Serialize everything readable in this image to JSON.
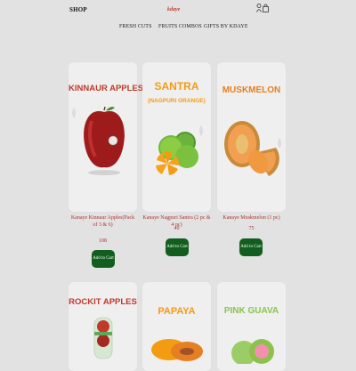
{
  "header": {
    "shop_label": "SHOP",
    "brand": "kdaye",
    "icons": [
      "user-icon",
      "bag-icon"
    ]
  },
  "nav": {
    "items": [
      {
        "label": "FRESH CUTS"
      },
      {
        "label": "FRUITS COMBOS"
      },
      {
        "label": "GIFTS BY KDAYE"
      }
    ]
  },
  "products": [
    {
      "title": "KINNAUR APPLES",
      "subtitle": "",
      "name": "Kanaye Kinnaur Apples(Pack of 3 & 6)",
      "price": "108",
      "button": "Add to Cart",
      "title_color": "#c0392b"
    },
    {
      "title": "SANTRA",
      "subtitle": "(NAGPURI ORANGE)",
      "name": "Kanaye Nagpuri Santra (2 pc & 4 pc)",
      "price": "49",
      "button": "Add to Cart",
      "title_color": "#f39c12"
    },
    {
      "title": "MUSKMELON",
      "subtitle": "",
      "name": "Kanaye Muskmelon (1 pc)",
      "price": "75",
      "button": "Add to Cart",
      "title_color": "#e67e22"
    },
    {
      "title": "ROCKIT APPLES",
      "subtitle": "",
      "title_color": "#c0392b"
    },
    {
      "title": "PAPAYA",
      "subtitle": "",
      "title_color": "#f39c12"
    },
    {
      "title": "PINK GUAVA",
      "subtitle": "",
      "title_color": "#8bc34a"
    }
  ],
  "colors": {
    "background": "#e2e2e2",
    "card": "#efefef",
    "button": "#125e1e",
    "product_text": "#a33"
  }
}
